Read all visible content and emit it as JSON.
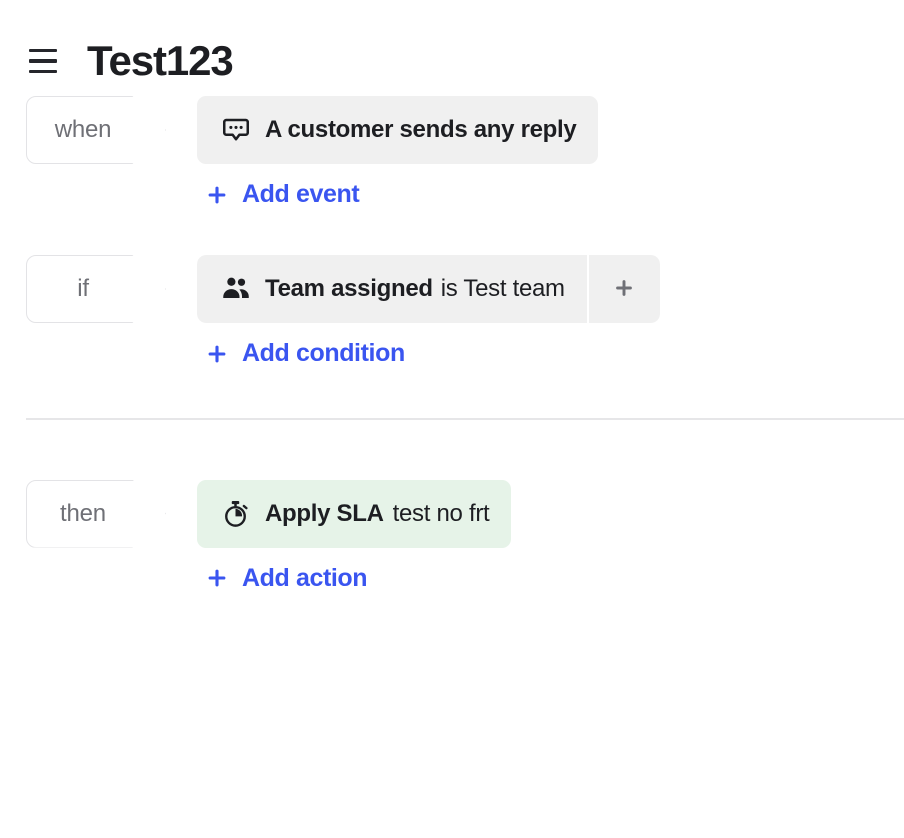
{
  "header": {
    "menu_icon": "hamburger-menu-icon",
    "title": "Test123"
  },
  "colors": {
    "accent_link": "#3a55f0",
    "chip_bg": "#f0f0f0",
    "chip_bg_green": "#e6f3e8",
    "tag_text": "#6f7076",
    "title_text": "#1d1e22",
    "divider": "#e6e6e8"
  },
  "rules": {
    "when": {
      "tag_label": "when",
      "events": [
        {
          "icon": "chat-bubble-dots-icon",
          "text": "A customer sends any reply"
        }
      ],
      "add_label": "Add event",
      "add_icon": "plus-icon"
    },
    "if": {
      "tag_label": "if",
      "conditions": [
        {
          "icon": "team-users-icon",
          "subject": "Team assigned",
          "predicate": "is Test team",
          "add_more_icon": "plus-icon"
        }
      ],
      "add_label": "Add condition",
      "add_icon": "plus-icon"
    },
    "then": {
      "tag_label": "then",
      "actions": [
        {
          "icon": "stopwatch-icon",
          "name": "Apply SLA",
          "value": "test no frt"
        }
      ],
      "add_label": "Add action",
      "add_icon": "plus-icon"
    }
  }
}
